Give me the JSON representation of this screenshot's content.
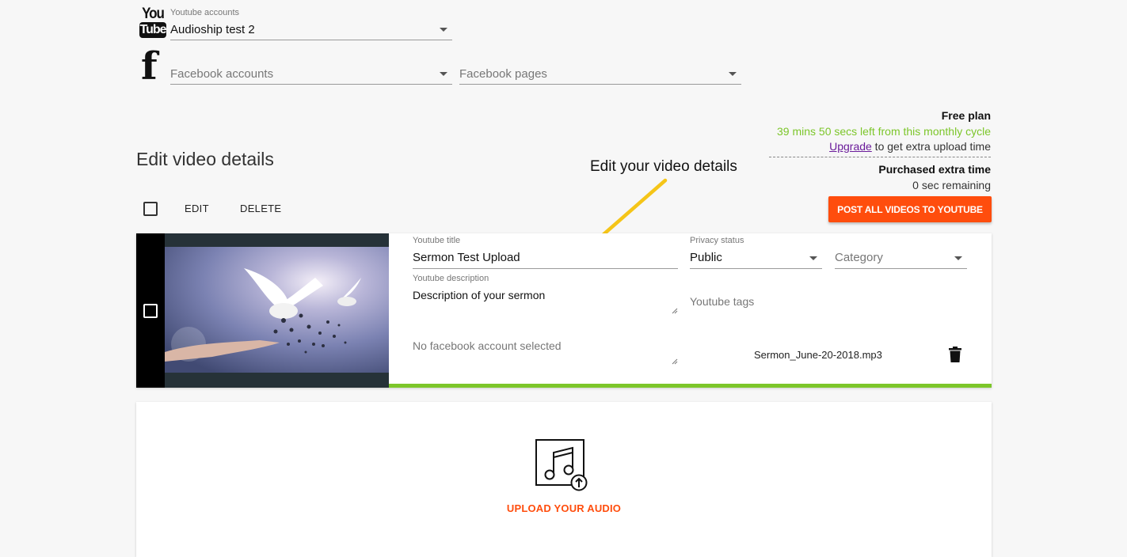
{
  "accounts": {
    "youtube": {
      "logo_you": "You",
      "logo_tube": "Tube",
      "label": "Youtube accounts",
      "value": "Audioship test 2"
    },
    "facebook": {
      "logo": "f",
      "accounts_placeholder": "Facebook accounts",
      "pages_placeholder": "Facebook pages"
    }
  },
  "plan": {
    "name": "Free plan",
    "time_left": "39 mins 50 secs left from this monthly cycle",
    "upgrade_link": "Upgrade",
    "upgrade_text": " to get extra upload time",
    "extra_title": "Purchased extra time",
    "extra_remaining": "0 sec remaining"
  },
  "page_title": "Edit video details",
  "annotation": "Edit your video details",
  "toolbar": {
    "edit_label": "EDIT",
    "delete_label": "DELETE",
    "post_all_label": "POST ALL VIDEOS TO YOUTUBE"
  },
  "video": {
    "title_label": "Youtube title",
    "title_value": "Sermon Test Upload",
    "description_label": "Youtube description",
    "description_value": "Description of your sermon",
    "privacy_label": "Privacy status",
    "privacy_value": "Public",
    "category_placeholder": "Category",
    "tags_placeholder": "Youtube tags",
    "facebook_placeholder": "No facebook account selected",
    "filename": "Sermon_June-20-2018.mp3",
    "upload_progress": 1.0
  },
  "upload": {
    "label": "UPLOAD YOUR AUDIO"
  },
  "colors": {
    "accent": "#ff4d0d",
    "progress": "#7cc62a",
    "annotation_arrow": "#f5c518",
    "link": "#6a1b9a"
  },
  "icons": {
    "youtube": "youtube-logo-icon",
    "facebook": "facebook-logo-icon",
    "delete": "trash-icon",
    "upload": "music-upload-icon",
    "arrow": "annotation-arrow-icon"
  }
}
